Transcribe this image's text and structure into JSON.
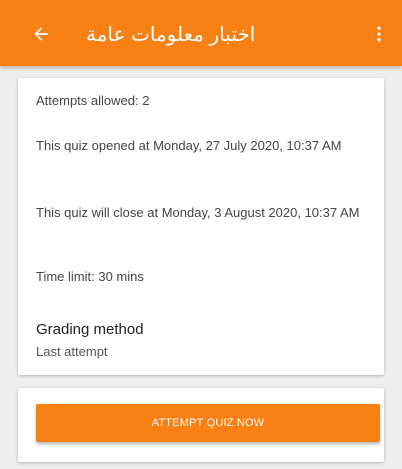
{
  "header": {
    "title": "اختبار معلومات عامة",
    "back_icon": "arrow-left-icon",
    "menu_icon": "more-vertical-icon",
    "color": "#f98012"
  },
  "quiz_info": {
    "attempts_allowed": "Attempts allowed: 2",
    "opened": "This quiz opened at Monday, 27 July 2020, 10:37 AM",
    "close": "This quiz will close at Monday, 3 August 2020, 10:37 AM",
    "time_limit": "Time limit: 30 mins",
    "grading_method_label": "Grading method",
    "grading_method_value": "Last attempt"
  },
  "actions": {
    "attempt_button": "ATTEMPT QUIZ NOW"
  }
}
